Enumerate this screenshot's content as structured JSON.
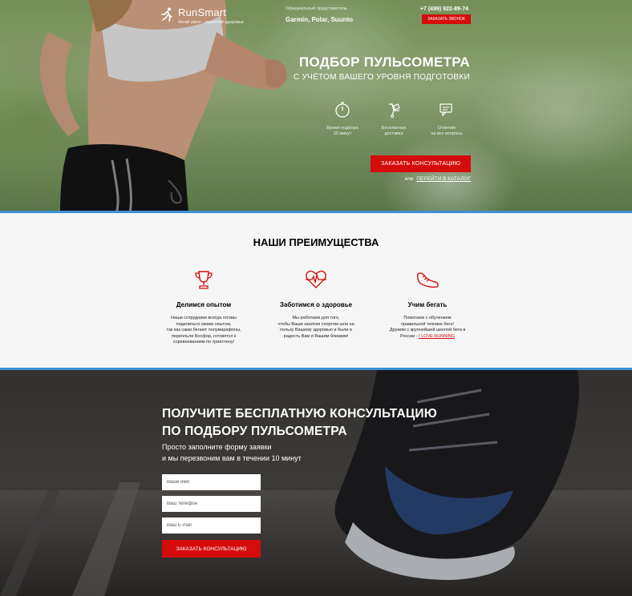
{
  "header": {
    "logo_name": "RunSmart",
    "logo_tagline": "бегай умно - укрепляй здоровье",
    "official_label": "Официальный представитель",
    "official_brands": "Garmin, Polar, Suunto",
    "phone": "+7 (499) 922-89-74",
    "call_button": "ЗАКАЗАТЬ ЗВОНОК"
  },
  "hero": {
    "title": "ПОДБОР ПУЛЬСОМЕТРА",
    "subtitle": "С УЧЁТОМ ВАШЕГО УРОВНЯ ПОДГОТОВКИ",
    "features": [
      {
        "icon": "stopwatch-icon",
        "line1": "Время подбора",
        "line2": "10 минут"
      },
      {
        "icon": "delivery-icon",
        "line1": "Бесплатная",
        "line2": "доставка"
      },
      {
        "icon": "chat-icon",
        "line1": "Ответим",
        "line2": "на все вопросы"
      }
    ],
    "consult_button": "ЗАКАЗАТЬ КОНСУЛЬТАЦИЮ",
    "catalog_prefix": "или",
    "catalog_link": "ПЕРЕЙТИ В КАТАЛОГ"
  },
  "advantages": {
    "title": "НАШИ ПРЕИМУЩЕСТВА",
    "items": [
      {
        "icon": "trophy-icon",
        "heading": "Делимся опытом",
        "lines": [
          "Наши сотрудники всегда готовы",
          "поделиться своим опытом,",
          "так как сами бегают полумарафоны,",
          "перепльли Босфор, готовятся к",
          "соревнованиям по триатлону!"
        ]
      },
      {
        "icon": "heartbeat-icon",
        "heading": "Заботимся о здоровье",
        "lines": [
          "Мы работаем для того,",
          "чтобы Ваши занятия спортом шли на",
          "пользу Вашему здоровью и были в",
          "радость Вам и Вашим близким!"
        ]
      },
      {
        "icon": "running-shoe-icon",
        "heading": "Учим бегать",
        "lines": [
          "Помогаем с обучением",
          "правильной технике бега!",
          "Дружим с крупнейшей школой бега в"
        ],
        "last_prefix": "России - ",
        "link": "I LOVE RUNNING"
      }
    ]
  },
  "form": {
    "title_line1": "ПОЛУЧИТЕ БЕСПЛАТНУЮ КОНСУЛЬТАЦИЮ",
    "title_line2": "ПО ПОДБОРУ ПУЛЬСОМЕТРА",
    "desc_line1": "Просто заполните форму заявки",
    "desc_line2": "и мы перезвоним вам в течении 10 минут",
    "name_placeholder": "Ваше имя",
    "phone_placeholder": "Ваш телефон",
    "email_placeholder": "Ваш E-mail",
    "submit": "ЗАКАЗАТЬ КОНСУЛЬТАЦИЮ"
  },
  "colors": {
    "accent": "#d40c0c",
    "divider": "#3b8fd8"
  }
}
